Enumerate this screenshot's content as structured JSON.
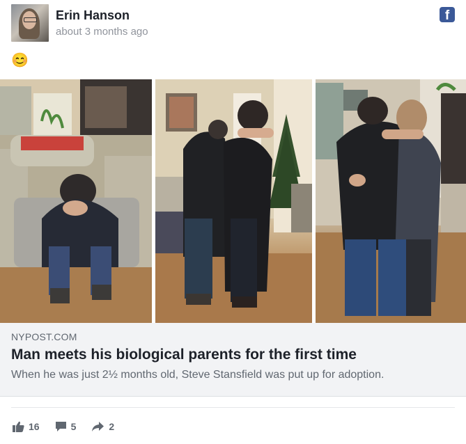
{
  "post": {
    "author": "Erin Hanson",
    "timestamp": "about 3 months ago",
    "text": "😊",
    "source_icon": "facebook-icon",
    "source_icon_glyph": "f"
  },
  "link": {
    "source": "NYPOST.COM",
    "title": "Man meets his biological parents for the first time",
    "description": "When he was just 2½ months old, Steve Stansfield was put up for adoption.",
    "image_panels": 3
  },
  "stats": {
    "likes": "16",
    "comments": "5",
    "shares": "2"
  },
  "colors": {
    "facebook_blue": "#3b5998",
    "meta_gray": "#90949c",
    "card_bg": "#f2f3f5"
  }
}
